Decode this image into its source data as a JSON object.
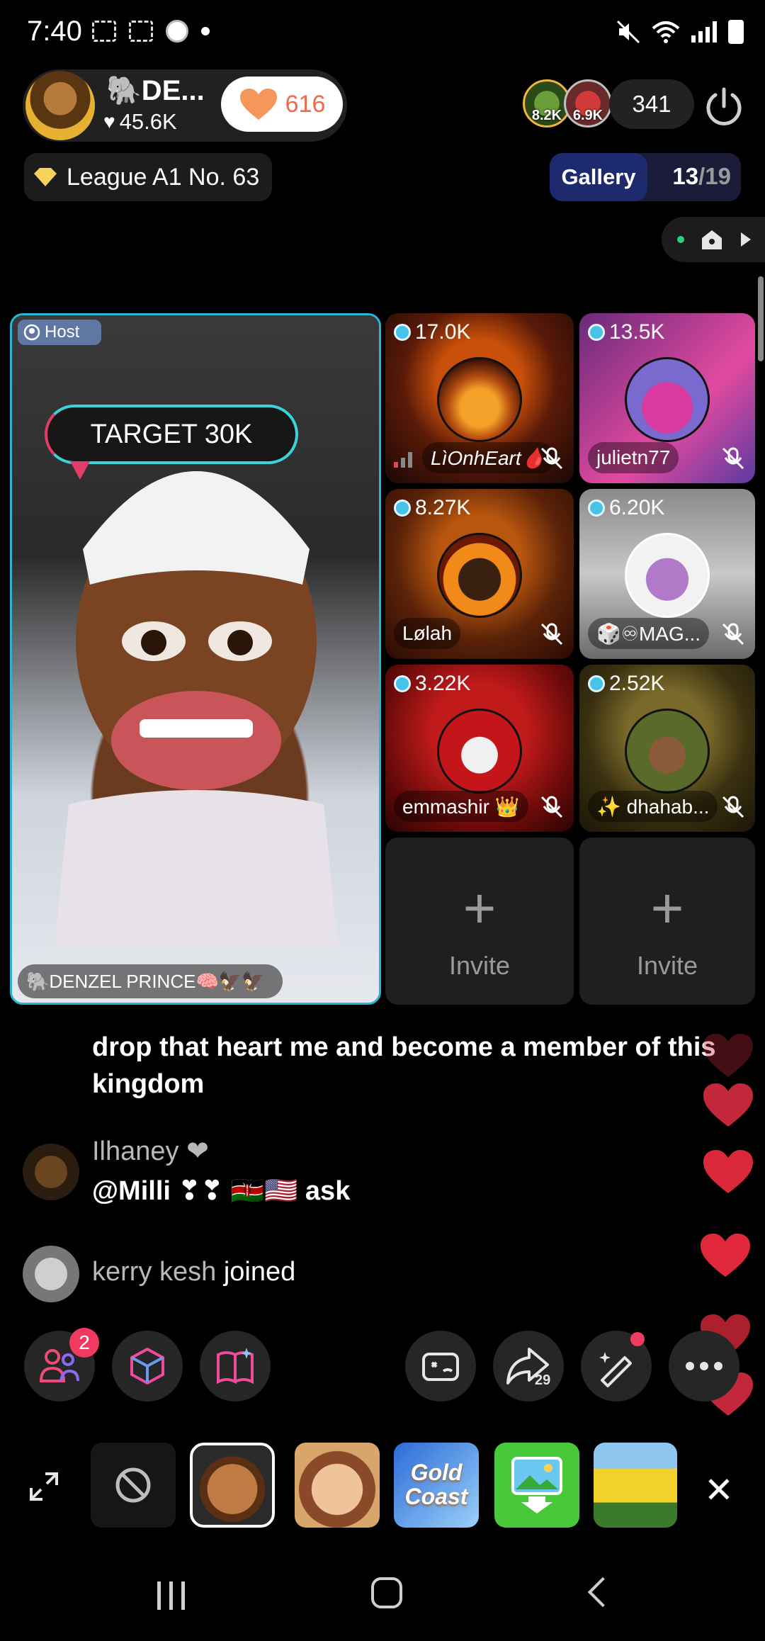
{
  "status_bar": {
    "time": "7:40"
  },
  "host": {
    "name": "🐘DE...",
    "likes": "45.6K",
    "follow_count": "616",
    "viewer_badges": [
      "8.2K",
      "6.9K"
    ],
    "viewer_count": "341",
    "league": "League A1 No. 63",
    "gallery_label": "Gallery",
    "gallery_current": "13",
    "gallery_total": "/19"
  },
  "host_tile": {
    "badge": "Host",
    "target_text": "TARGET 30K",
    "nameplate": "🐘DENZEL PRINCE🧠🦅🦅"
  },
  "guests": [
    {
      "count": "17.0K",
      "name": "LìOnhEart🩸"
    },
    {
      "count": "13.5K",
      "name": "julietn77"
    },
    {
      "count": "8.27K",
      "name": "Lølah"
    },
    {
      "count": "6.20K",
      "name": "🎲♾MAG..."
    },
    {
      "count": "3.22K",
      "name": "emmashir 👑"
    },
    {
      "count": "2.52K",
      "name": "✨ dhahab..."
    }
  ],
  "invite": {
    "plus": "+",
    "label": "Invite"
  },
  "comments": [
    {
      "text": "drop that heart me and become a member of this kingdom"
    },
    {
      "user": "Ilhaney ❤",
      "text": "@Milli ❣❣ 🇰🇪🇺🇸 ask"
    },
    {
      "user": "kerry kesh",
      "text": " joined"
    }
  ],
  "actions": {
    "notif_count": "2",
    "share_count": "29"
  },
  "effects": {
    "gold_coast_line1": "Gold",
    "gold_coast_line2": "Coast"
  },
  "colors": {
    "accent": "#2ab5d6",
    "heart": "#e23c4a",
    "badge": "#f03a5f"
  }
}
